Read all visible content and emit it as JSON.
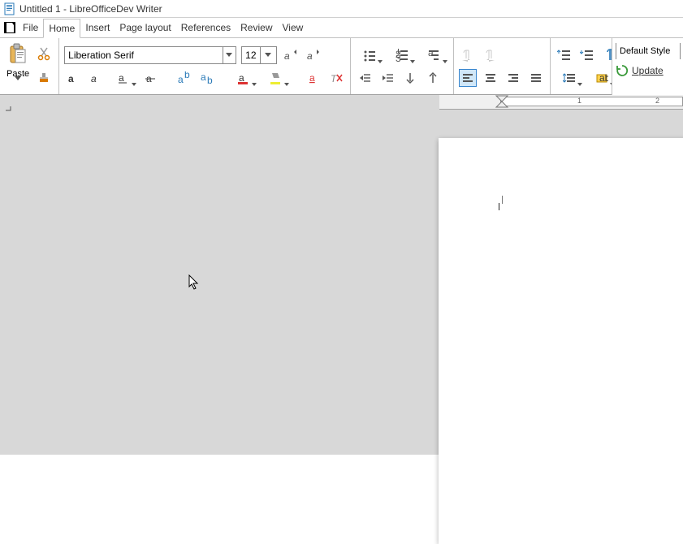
{
  "title": "Untitled 1 - LibreOfficeDev Writer",
  "menu": {
    "file": "File",
    "home": "Home",
    "insert": "Insert",
    "page_layout": "Page layout",
    "references": "References",
    "review": "Review",
    "view": "View"
  },
  "clipboard": {
    "paste": "Paste"
  },
  "font": {
    "name": "Liberation Serif",
    "size": "12"
  },
  "style": {
    "default": "Default Style",
    "update": "Update"
  },
  "icons": {
    "grow_font": "grow-font",
    "shrink_font": "shrink-font",
    "bold": "bold",
    "italic": "italic",
    "underline": "underline",
    "strike": "strike",
    "super": "superscript",
    "sub": "subscript",
    "char_color": "char-color",
    "highlight": "highlight",
    "bucket": "paint-bucket",
    "clear": "clear-format",
    "bullets": "bullets",
    "numbers": "numbering",
    "outline": "outline",
    "indent_less": "decrease-indent",
    "indent_more": "increase-indent",
    "lpara": "left-to-right",
    "rpara": "right-to-left",
    "align_l": "align-left",
    "align_c": "align-center",
    "align_r": "align-right",
    "align_j": "align-justify",
    "line_sp": "line-spacing",
    "para_sp": "paragraph-spacing",
    "pilcrow": "pilcrow",
    "ins_row": "insert-row",
    "ins_col": "insert-col",
    "list_style": "list-style",
    "num_style": "num-style",
    "cut": "cut",
    "copy": "copy",
    "clone": "clone-format",
    "paste_big": "paste"
  },
  "ruler": {
    "t1": "1",
    "t2": "2"
  }
}
